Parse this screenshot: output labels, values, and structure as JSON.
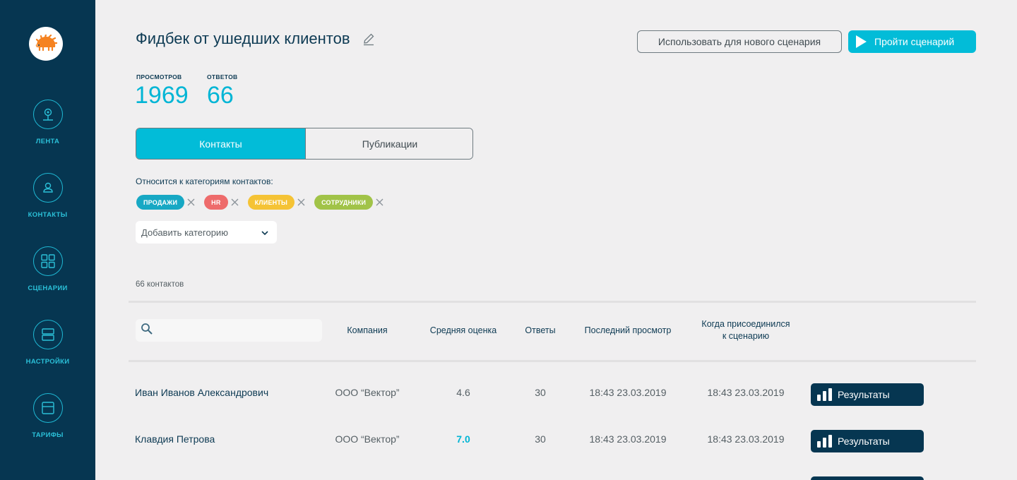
{
  "sidebar": {
    "logo_icon": "hedgehog-logo",
    "items": [
      {
        "label": "ЛЕНТА",
        "icon": "feed-icon"
      },
      {
        "label": "КОНТАКТЫ",
        "icon": "user-icon"
      },
      {
        "label": "СЦЕНАРИИ",
        "icon": "grid-icon"
      },
      {
        "label": "НАСТРОЙКИ",
        "icon": "settings-icon"
      },
      {
        "label": "ТАРИФЫ",
        "icon": "tariff-icon"
      }
    ]
  },
  "header": {
    "title": "Фидбек от ушедших клиентов",
    "use_button": "Использовать для нового сценария",
    "run_button": "Пройти сценарий"
  },
  "stats": {
    "views_label": "ПРОСМОТРОВ",
    "views_value": "1969",
    "answers_label": "ОТВЕТОВ",
    "answers_value": "66"
  },
  "tabs": [
    {
      "label": "Контакты",
      "active": true
    },
    {
      "label": "Публикации",
      "active": false
    }
  ],
  "categories": {
    "label": "Относится к категориям контактов:",
    "chips": [
      {
        "label": "ПРОДАЖИ",
        "color": "#17a8c4"
      },
      {
        "label": "HR",
        "color": "#ee6b6b"
      },
      {
        "label": "КЛИЕНТЫ",
        "color": "#f5c335"
      },
      {
        "label": "СОТРУДНИКИ",
        "color": "#a1c348"
      }
    ],
    "add_placeholder": "Добавить категорию"
  },
  "contacts_count": "66 контактов",
  "table": {
    "headers": {
      "company": "Компания",
      "avg_score": "Средняя оценка",
      "answers": "Ответы",
      "last_view": "Последний просмотр",
      "joined_line1": "Когда присоединился",
      "joined_line2": "к сценарию"
    },
    "results_label": "Результаты",
    "rows": [
      {
        "name": "Иван Иванов Александрович",
        "company": "ООО “Вектор”",
        "score": "4.6",
        "answers": "30",
        "last_view": "18:43 23.03.2019",
        "joined": "18:43 23.03.2019"
      },
      {
        "name": "Клавдия Петрова",
        "company": "ООО “Вектор”",
        "score": "7.0",
        "answers": "30",
        "last_view": "18:43 23.03.2019",
        "joined": "18:43 23.03.2019"
      }
    ]
  },
  "colors": {
    "sidebar_bg": "#063651",
    "accent": "#02bcd8",
    "dark_button": "#063651"
  }
}
